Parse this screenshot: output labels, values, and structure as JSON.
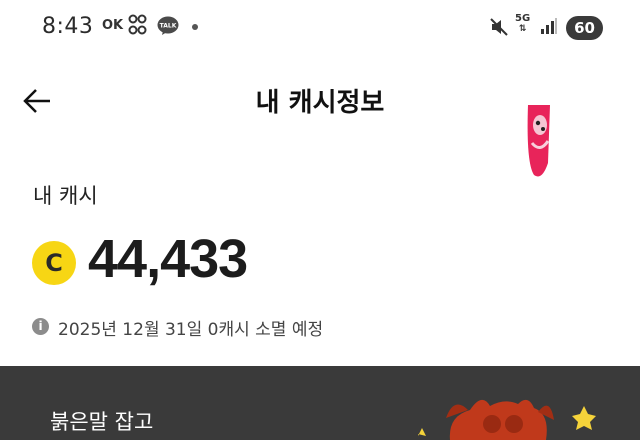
{
  "status_bar": {
    "time": "8:43",
    "ok_label": "OK",
    "talk_label": "TALK",
    "network": "5G",
    "battery": "60"
  },
  "header": {
    "title": "내 캐시정보"
  },
  "cash": {
    "label": "내 캐시",
    "coin_symbol": "C",
    "amount": "44,433",
    "expire_note": "2025년 12월 31일 0캐시 소멸 예정",
    "info_symbol": "i"
  },
  "banner": {
    "title": "붉은말 잡고"
  },
  "colors": {
    "coin": "#f7d614",
    "banner_bg": "#3a3a3a",
    "promo_accent": "#e8245a",
    "mascot": "#c0391b"
  }
}
